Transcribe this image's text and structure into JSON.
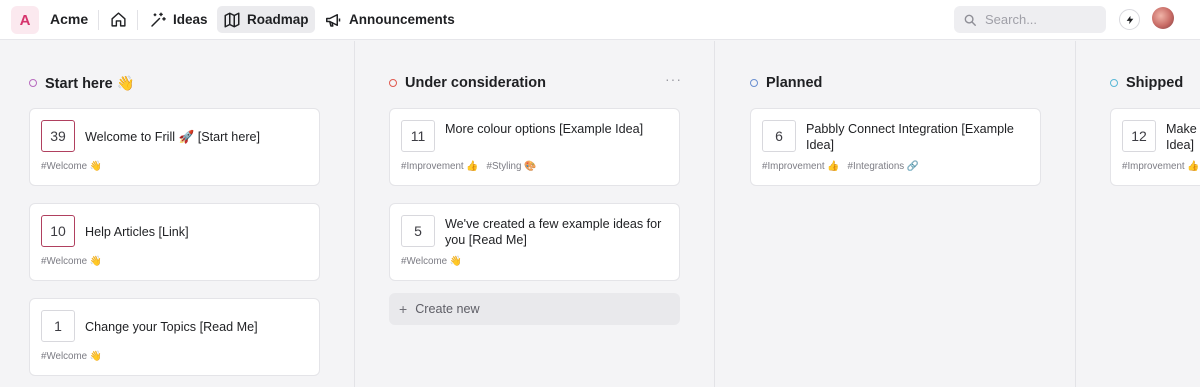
{
  "app": {
    "logo_letter": "A",
    "brand": "Acme"
  },
  "nav": {
    "home_icon": "home-icon",
    "items": [
      {
        "label": "Ideas",
        "icon": "magic-wand-icon",
        "active": false
      },
      {
        "label": "Roadmap",
        "icon": "map-icon",
        "active": true
      },
      {
        "label": "Announcements",
        "icon": "megaphone-icon",
        "active": false
      }
    ]
  },
  "search": {
    "placeholder": "Search...",
    "icon": "search-icon"
  },
  "header_actions": {
    "bolt_icon": "lightning-icon",
    "avatar": "user-avatar"
  },
  "colors": {
    "accent": "#d6336c",
    "vote_highlight": "#b0405f"
  },
  "columns": [
    {
      "title": "Start here 👋",
      "dot_color": "#b86bbf",
      "cards": [
        {
          "votes": "39",
          "title": "Welcome to Frill 🚀 [Start here]",
          "tags": [
            "#Welcome 👋"
          ],
          "highlight": true
        },
        {
          "votes": "10",
          "title": "Help Articles [Link]",
          "tags": [
            "#Welcome 👋"
          ],
          "highlight": true
        },
        {
          "votes": "1",
          "title": "Change your Topics [Read Me]",
          "tags": [
            "#Welcome 👋"
          ],
          "highlight": false
        }
      ]
    },
    {
      "title": "Under consideration",
      "dot_color": "#e0594f",
      "more_label": "···",
      "cards": [
        {
          "votes": "11",
          "title": "More colour options [Example Idea]",
          "tags": [
            "#Improvement 👍",
            "#Styling 🎨"
          ],
          "highlight": false
        },
        {
          "votes": "5",
          "title": "We've created a few example ideas for you [Read Me]",
          "tags": [
            "#Welcome 👋"
          ],
          "highlight": false
        }
      ],
      "create_label": "Create new"
    },
    {
      "title": "Planned",
      "dot_color": "#6a8fd0",
      "cards": [
        {
          "votes": "6",
          "title": "Pabbly Connect Integration [Example Idea]",
          "tags": [
            "#Improvement 👍",
            "#Integrations 🔗"
          ],
          "highlight": false
        }
      ]
    },
    {
      "title": "Shipped",
      "dot_color": "#59b7d6",
      "cards": [
        {
          "votes": "12",
          "title": "Make Idea]",
          "tags": [
            "#Improvement 👍"
          ],
          "highlight": false
        }
      ]
    }
  ]
}
